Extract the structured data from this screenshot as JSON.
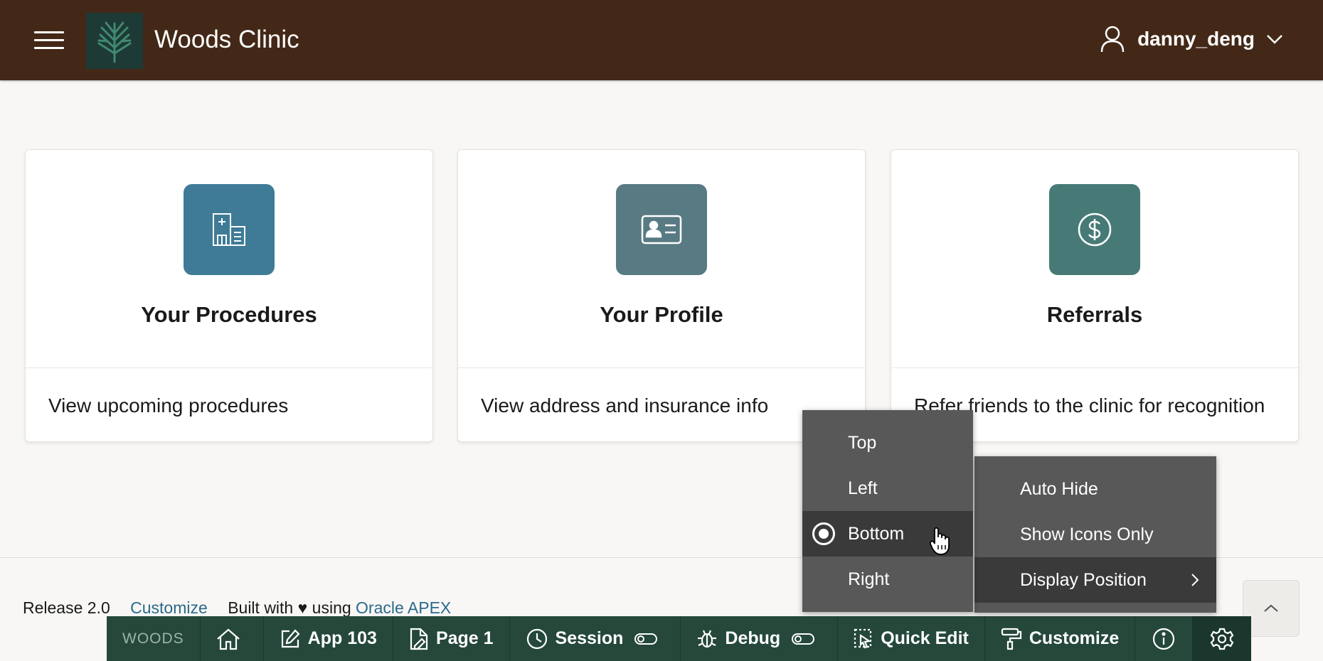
{
  "header": {
    "app_title": "Woods Clinic",
    "user_name": "danny_deng",
    "icons": [
      "hamburger-menu-icon",
      "tree-logo-icon",
      "user-icon",
      "chevron-down-icon"
    ]
  },
  "cards": [
    {
      "title": "Your Procedures",
      "subtitle": "View upcoming procedures",
      "icon": "hospital-icon",
      "color": "#3f7b96"
    },
    {
      "title": "Your Profile",
      "subtitle": "View address and insurance info",
      "icon": "id-card-icon",
      "color": "#587a82"
    },
    {
      "title": "Referrals",
      "subtitle": "Refer friends to the clinic for recognition",
      "icon": "dollar-circle-icon",
      "color": "#477a76"
    }
  ],
  "footer": {
    "release": "Release 2.0",
    "customize_link": "Customize",
    "built_with": "Built with",
    "using": "using",
    "apex_link": "Oracle APEX"
  },
  "devbar": {
    "brand": "WOODS",
    "app": "App 103",
    "page": "Page 1",
    "session": "Session",
    "debug": "Debug",
    "quick_edit": "Quick Edit",
    "customize": "Customize"
  },
  "settings_menu": {
    "items": [
      "Auto Hide",
      "Show Icons Only",
      "Display Position"
    ],
    "active_item": "Display Position"
  },
  "position_submenu": {
    "items": [
      "Top",
      "Left",
      "Bottom",
      "Right"
    ],
    "selected": "Bottom"
  },
  "colors": {
    "header_bg": "#432818",
    "devbar_bg": "#25483b",
    "menu_bg": "#585858",
    "link": "#2b6a8a"
  }
}
